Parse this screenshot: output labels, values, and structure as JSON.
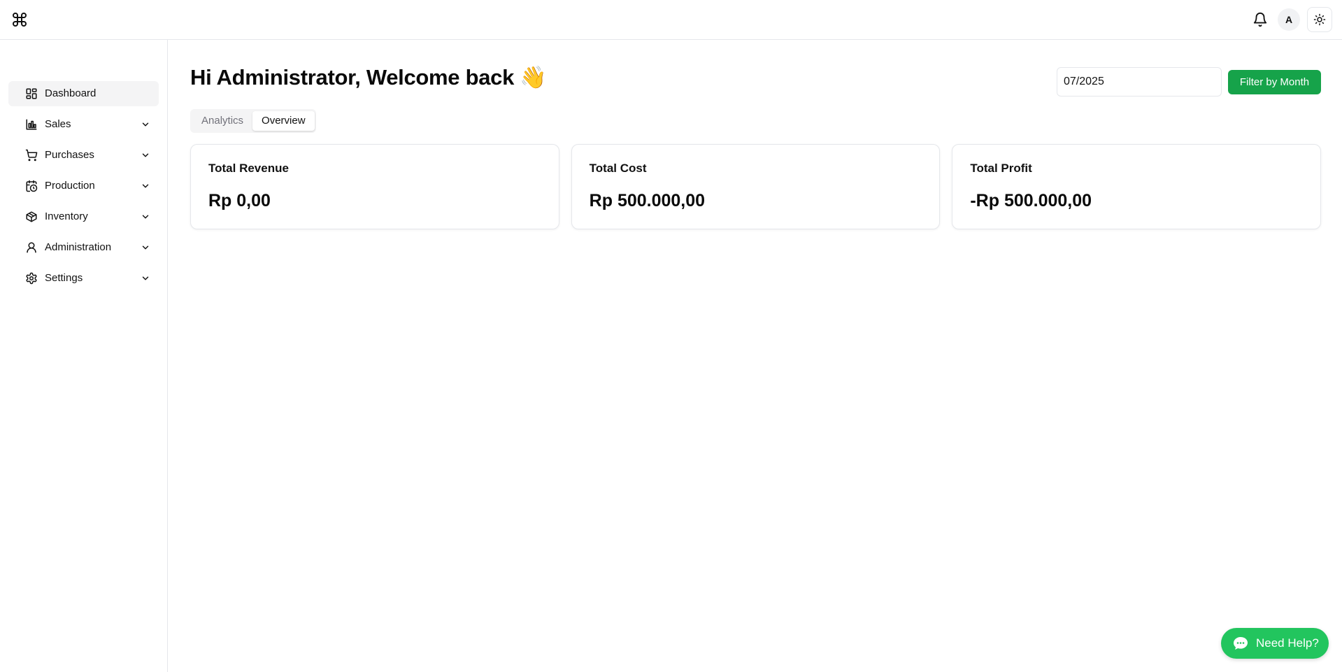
{
  "header": {
    "logo_icon": "command-icon",
    "notifications_icon": "bell-icon",
    "avatar_initial": "A",
    "theme_icon": "sun-icon"
  },
  "sidebar": {
    "items": [
      {
        "label": "Dashboard",
        "icon": "dashboard-icon",
        "active": true
      },
      {
        "label": "Sales",
        "icon": "bar-chart-icon",
        "expandable": true
      },
      {
        "label": "Purchases",
        "icon": "cart-icon",
        "expandable": true
      },
      {
        "label": "Production",
        "icon": "calendar-clock-icon",
        "expandable": true
      },
      {
        "label": "Inventory",
        "icon": "package-icon",
        "expandable": true
      },
      {
        "label": "Administration",
        "icon": "user-icon",
        "expandable": true
      },
      {
        "label": "Settings",
        "icon": "gear-icon",
        "expandable": true
      }
    ]
  },
  "main": {
    "greeting": "Hi Administrator, Welcome back 👋",
    "month_filter": {
      "value": "07/2025",
      "button_label": "Filter by Month"
    },
    "tabs": [
      {
        "label": "Analytics",
        "active": false
      },
      {
        "label": "Overview",
        "active": true
      }
    ],
    "cards": [
      {
        "title": "Total Revenue",
        "value": "Rp 0,00"
      },
      {
        "title": "Total Cost",
        "value": "Rp 500.000,00"
      },
      {
        "title": "Total Profit",
        "value": "-Rp 500.000,00"
      }
    ]
  },
  "help": {
    "label": "Need Help?",
    "icon": "chat-bubble-icon"
  },
  "colors": {
    "accent": "#16a34a",
    "help": "#22c55e",
    "border": "#e5e7eb"
  }
}
